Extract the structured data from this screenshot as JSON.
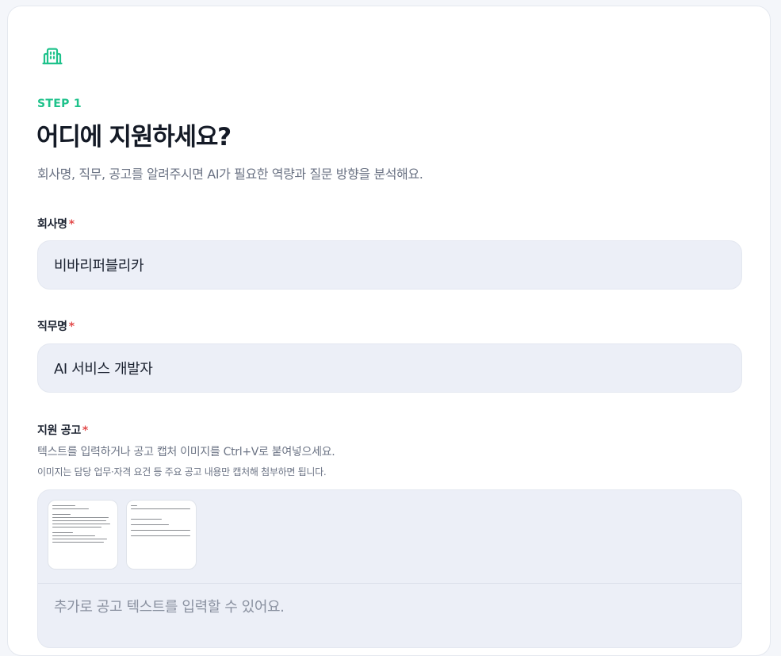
{
  "header": {
    "icon": "building-icon",
    "accent_color": "#1ec28b",
    "step": "STEP 1",
    "title": "어디에 지원하세요?",
    "subtitle": "회사명, 직무, 공고를 알려주시면 AI가 필요한 역량과 질문 방향을 분석해요."
  },
  "company": {
    "label": "회사명",
    "required_mark": "*",
    "value": "비바리퍼블리카"
  },
  "job": {
    "label": "직무명",
    "required_mark": "*",
    "value": "AI 서비스 개발자"
  },
  "posting": {
    "label": "지원 공고",
    "required_mark": "*",
    "hint": "텍스트를 입력하거나 공고 캡처 이미지를 Ctrl+V로 붙여넣으세요.",
    "sub_hint": "이미지는 담당 업무·자격 요건 등 주요 공고 내용만 캡처해 첨부하면 됩니다.",
    "placeholder": "추가로 공고 텍스트를 입력할 수 있어요.",
    "attachments": [
      "attachment-thumbnail-1",
      "attachment-thumbnail-2"
    ]
  }
}
